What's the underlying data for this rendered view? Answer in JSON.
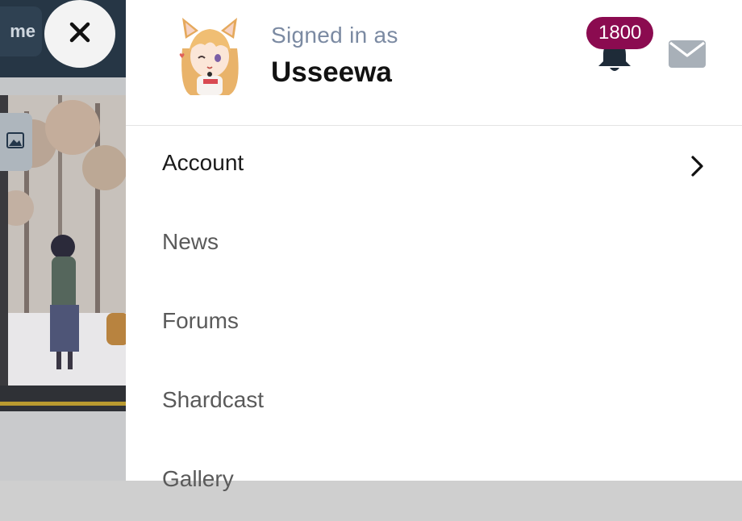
{
  "background": {
    "home_button_label": "me"
  },
  "profile": {
    "signed_in_label": "Signed in as",
    "username": "Usseewa",
    "notification_count": "1800"
  },
  "menu": {
    "items": [
      {
        "label": "Account"
      },
      {
        "label": "News"
      },
      {
        "label": "Forums"
      },
      {
        "label": "Shardcast"
      },
      {
        "label": "Gallery"
      }
    ]
  },
  "colors": {
    "badge": "#8b0b50",
    "signed_label": "#7b8aa2",
    "header_dark": "#263645"
  },
  "icons": [
    "close-icon",
    "bell-icon",
    "mail-icon",
    "chevron-right-icon",
    "image-upload-icon"
  ]
}
